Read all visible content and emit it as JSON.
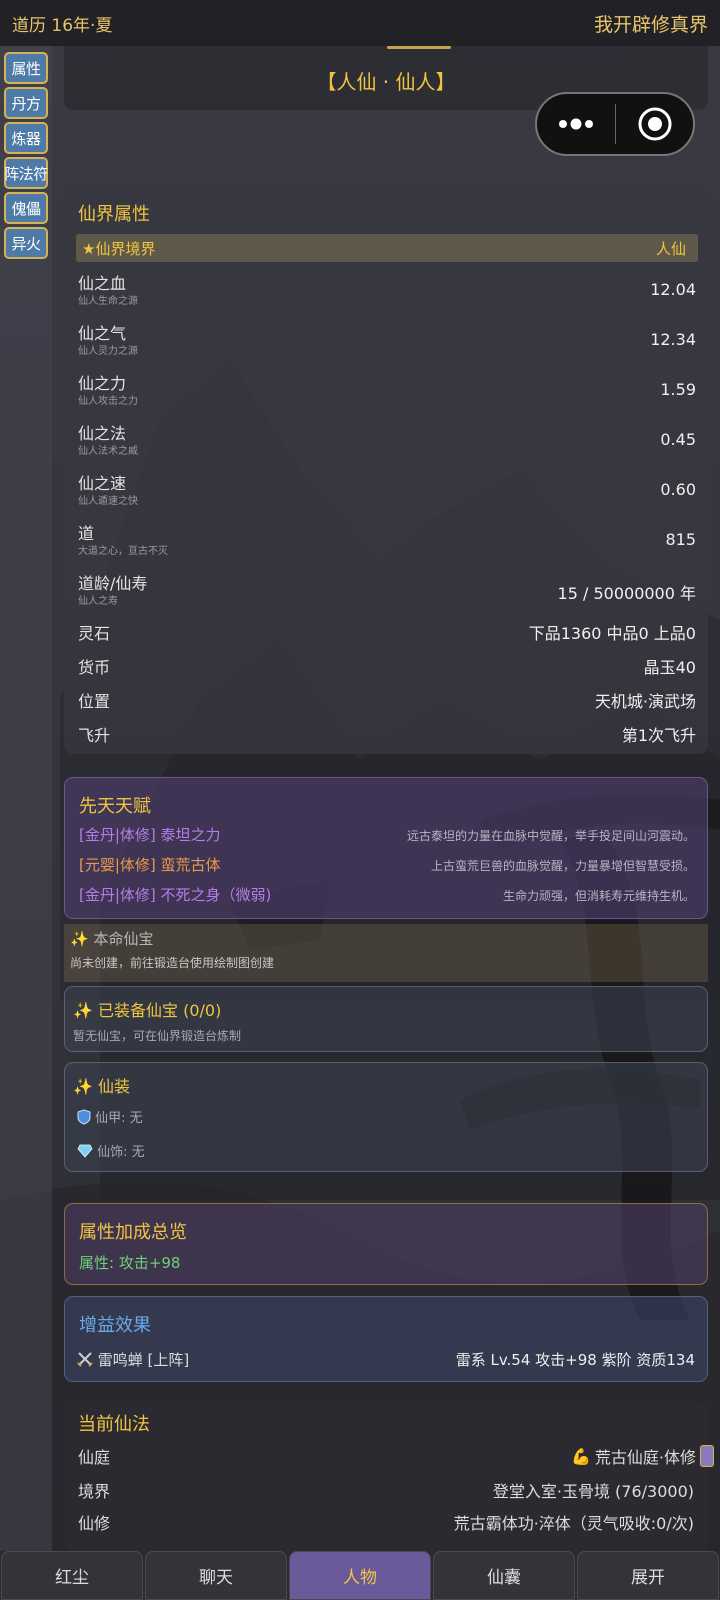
{
  "header": {
    "era": "道历 16年·夏",
    "title": "我开辟修真界"
  },
  "sidenav": [
    "属性",
    "丹方",
    "炼器",
    "阵法符",
    "傀儡",
    "异火"
  ],
  "realm_banner": "【人仙 · 仙人】",
  "attributes": {
    "title": "仙界属性",
    "realm_label": "★仙界境界",
    "realm_value": "人仙",
    "stats": [
      {
        "name": "仙之血",
        "sub": "仙人生命之源",
        "value": "12.04"
      },
      {
        "name": "仙之气",
        "sub": "仙人灵力之源",
        "value": "12.34"
      },
      {
        "name": "仙之力",
        "sub": "仙人攻击之力",
        "value": "1.59"
      },
      {
        "name": "仙之法",
        "sub": "仙人法术之威",
        "value": "0.45"
      },
      {
        "name": "仙之速",
        "sub": "仙人遁速之快",
        "value": "0.60"
      },
      {
        "name": "道",
        "sub": "大道之心，亘古不灭",
        "value": "815"
      },
      {
        "name": "道龄/仙寿",
        "sub": "仙人之寿",
        "value": "15 / 50000000 年"
      }
    ],
    "rows": [
      {
        "name": "灵石",
        "value": "下品1360  中品0  上品0"
      },
      {
        "name": "货币",
        "value": "晶玉40"
      },
      {
        "name": "位置",
        "value": "天机城·演武场"
      },
      {
        "name": "飞升",
        "value": "第1次飞升"
      }
    ]
  },
  "talents": {
    "title": "先天天赋",
    "items": [
      {
        "name": "[金丹|体修] 泰坦之力",
        "desc": "远古泰坦的力量在血脉中觉醒，举手投足间山河震动。",
        "color": "#b47ee6"
      },
      {
        "name": "[元婴|体修] 蛮荒古体",
        "desc": "上古蛮荒巨兽的血脉觉醒，力量暴增但智慧受损。",
        "color": "#e89a4a"
      },
      {
        "name": "[金丹|体修] 不死之身（微弱)",
        "desc": "生命力顽强，但消耗寿元维持生机。",
        "color": "#b47ee6"
      }
    ]
  },
  "benming": {
    "title": "本命仙宝",
    "desc": "尚未创建，前往锻造台使用绘制图创建"
  },
  "equipped": {
    "title": "已装备仙宝 (0/0)",
    "desc": "暂无仙宝，可在仙界锻造台炼制"
  },
  "outfit": {
    "title": "仙装",
    "armor": "仙甲: 无",
    "ornament": "仙饰: 无"
  },
  "bonus": {
    "title": "属性加成总览",
    "text": "属性: 攻击+98"
  },
  "buff": {
    "title": "增益效果",
    "pet_name": "雷鸣蝉 [上阵]",
    "pet_info": "雷系 Lv.54  攻击+98  紫阶  资质134"
  },
  "spell": {
    "title": "当前仙法",
    "rows": [
      {
        "name": "仙庭",
        "value": "荒古仙庭·体修"
      },
      {
        "name": "境界",
        "value": "登堂入室·玉骨境 (76/3000)"
      },
      {
        "name": "仙修",
        "value": "荒古霸体功·淬体（灵气吸收:0/次)"
      }
    ]
  },
  "bottom_nav": [
    "红尘",
    "聊天",
    "人物",
    "仙囊",
    "展开"
  ],
  "active_tab": "人物",
  "colors": {
    "gold": "#f0c440",
    "nav_blue": "#4d7aa6",
    "active_tab": "#6a5a9a",
    "green": "#6fcf7a",
    "blue_title": "#6aa8e8"
  }
}
